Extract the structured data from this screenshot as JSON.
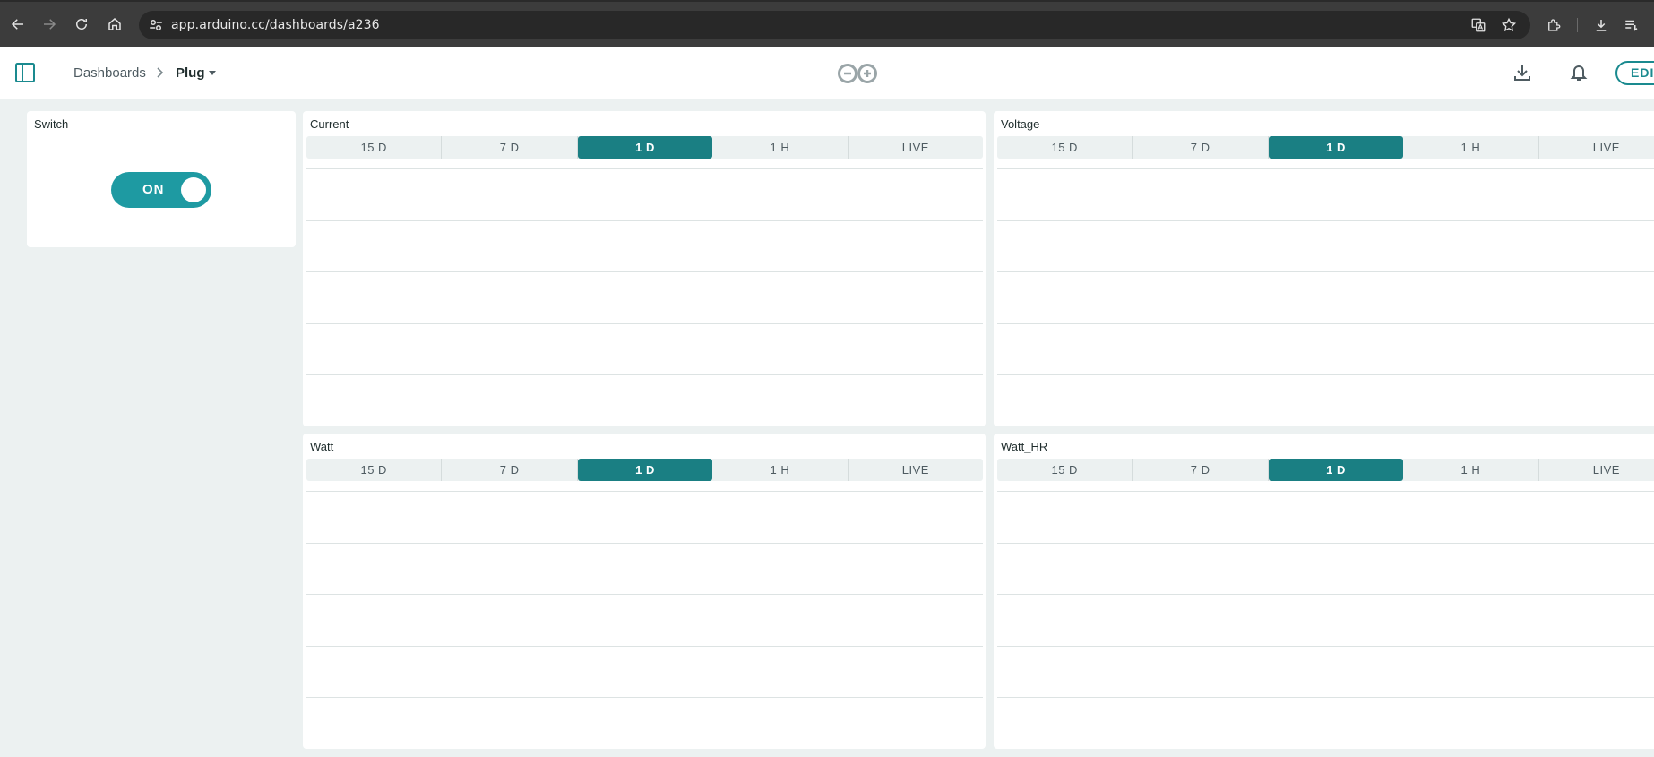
{
  "browser": {
    "url": "app.arduino.cc/dashboards/a236"
  },
  "header": {
    "breadcrumb_root": "Dashboards",
    "breadcrumb_current": "Plug",
    "edit_label": "EDIT"
  },
  "switch_widget": {
    "title": "Switch",
    "state_label": "ON",
    "is_on": true
  },
  "range_options": [
    "15 D",
    "7 D",
    "1 D",
    "1 H",
    "LIVE"
  ],
  "selected_range": "1 D",
  "charts": [
    {
      "title": "Current",
      "ranges": [
        "15 D",
        "7 D",
        "1 D",
        "1 H",
        "LIVE"
      ]
    },
    {
      "title": "Voltage",
      "ranges": [
        "15 D",
        "7 D",
        "1 D",
        "1 H",
        "LIVE"
      ]
    },
    {
      "title": "Watt",
      "ranges": [
        "15 D",
        "7 D",
        "1 D",
        "1 H",
        "LIVE"
      ]
    },
    {
      "title": "Watt_HR",
      "ranges": [
        "15 D",
        "7 D",
        "1 D",
        "1 H",
        "LIVE"
      ]
    }
  ],
  "colors": {
    "accent": "#1a7f83",
    "switch_on": "#1e9aa2",
    "page_background": "#ecf1f1",
    "browser_chrome": "#3c3c3c"
  },
  "icons": {
    "back": "arrow-left-icon",
    "forward": "arrow-right-icon",
    "reload": "reload-icon",
    "home": "home-icon",
    "site_info": "tune-icon",
    "translate": "translate-icon",
    "bookmark": "star-icon",
    "extensions": "puzzle-icon",
    "downloads": "download-icon",
    "reading_list": "reading-list-icon",
    "sidebar": "sidebar-toggle-icon",
    "logo": "arduino-logo-icon",
    "download_dashboard": "download-icon",
    "notifications": "bell-icon"
  }
}
